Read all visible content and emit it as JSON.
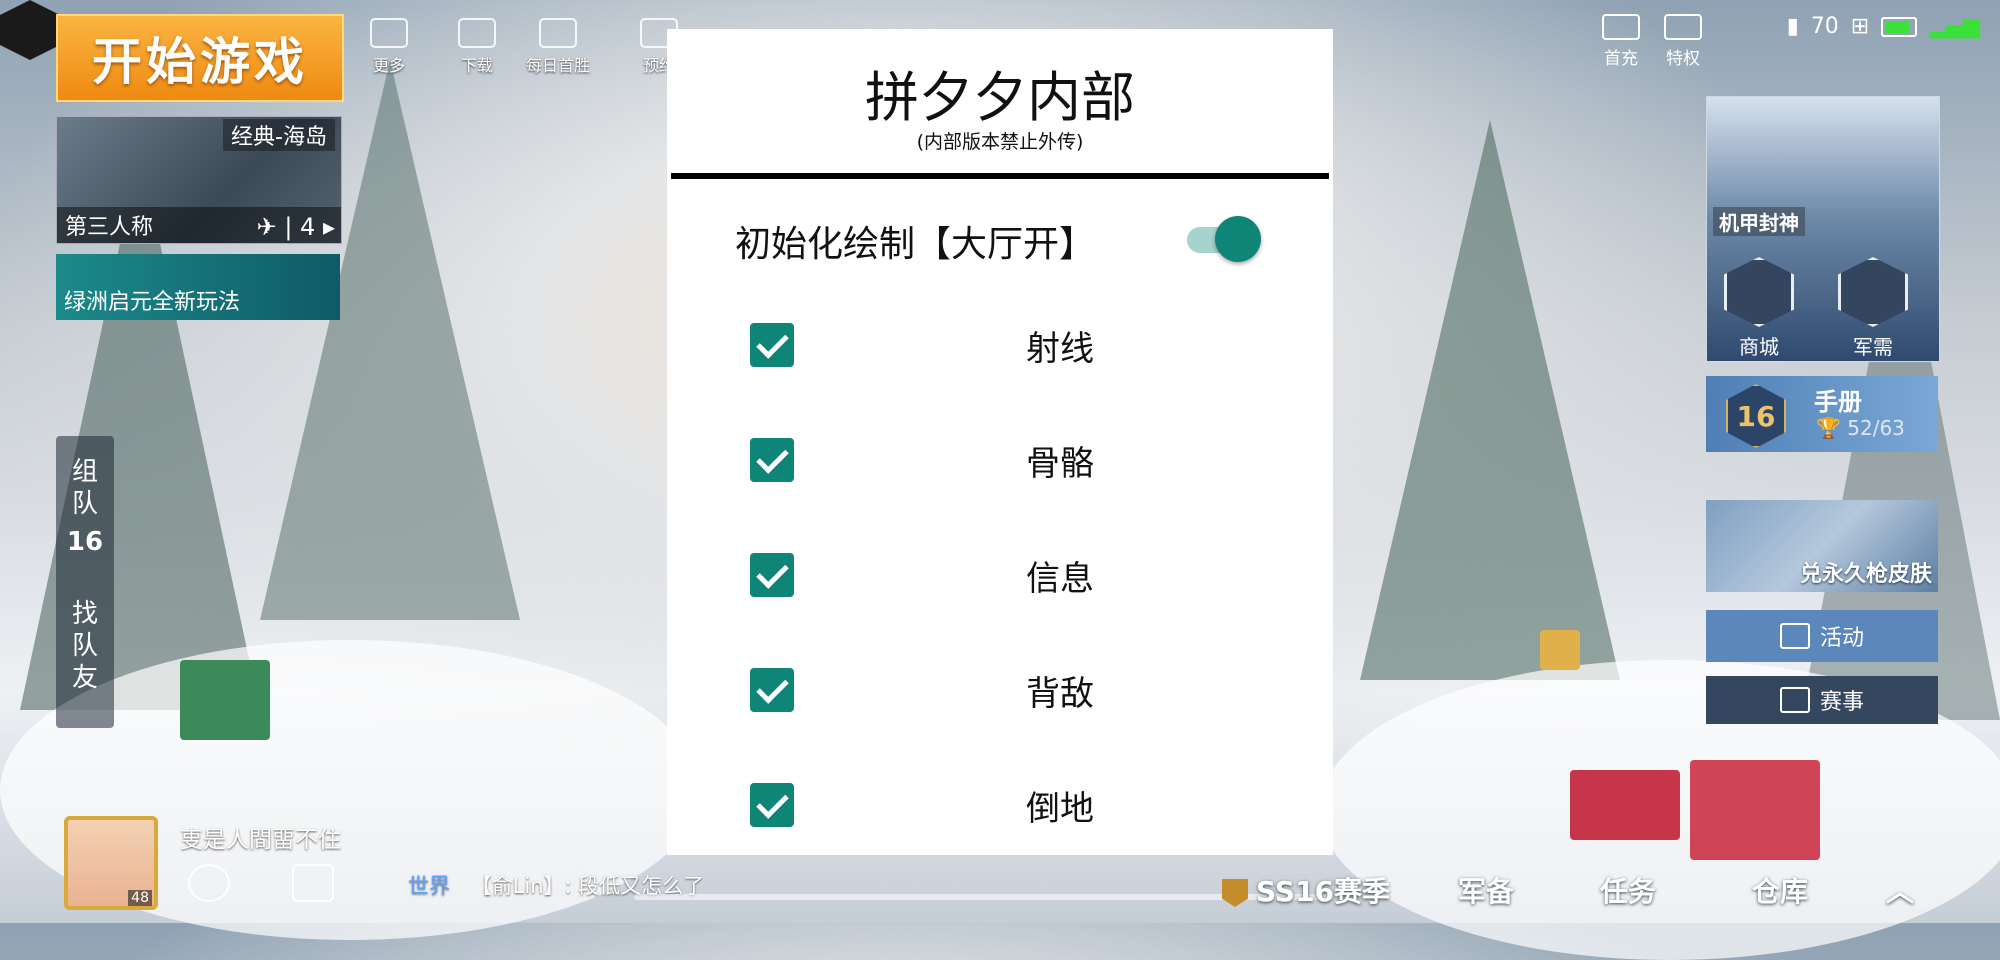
{
  "lobby": {
    "start_button": "开始游戏",
    "mode": {
      "map": "经典-海岛",
      "perspective": "第三人称",
      "squad_count": "4"
    },
    "event_banner": "绿洲启元全新玩法",
    "top_icons": [
      "更多",
      "下载",
      "每日首胜",
      "预约"
    ],
    "team": {
      "group": [
        "组",
        "队"
      ],
      "level": "16",
      "find": [
        "找",
        "队",
        "友"
      ]
    },
    "top_right": {
      "first_charge": "首充",
      "privilege": "特权",
      "coins": "70"
    },
    "right_cards": {
      "mech_label": "机甲封神",
      "shop": "商城",
      "military": "军需",
      "manual_title": "手册",
      "manual_level": "16",
      "manual_progress": "52/63",
      "skin": "兑永久枪皮肤",
      "activity": "活动",
      "match": "赛事"
    },
    "player": {
      "name": "叓是人間畱不住",
      "level": "48"
    },
    "chat": {
      "channel": "世界",
      "message": "【俞Lin】: 段低又怎么了"
    },
    "bottom_nav": [
      "SS16赛季",
      "军备",
      "任务",
      "仓库"
    ]
  },
  "menu": {
    "title": "拼夕夕内部",
    "subtitle": "(内部版本禁止外传)",
    "toggle_label": "初始化绘制【大厅开】",
    "toggle_on": true,
    "options": [
      {
        "label": "射线",
        "checked": true
      },
      {
        "label": "骨骼",
        "checked": true
      },
      {
        "label": "信息",
        "checked": true
      },
      {
        "label": "背敌",
        "checked": true
      },
      {
        "label": "倒地",
        "checked": true
      }
    ],
    "accent_color": "#0f8577"
  }
}
